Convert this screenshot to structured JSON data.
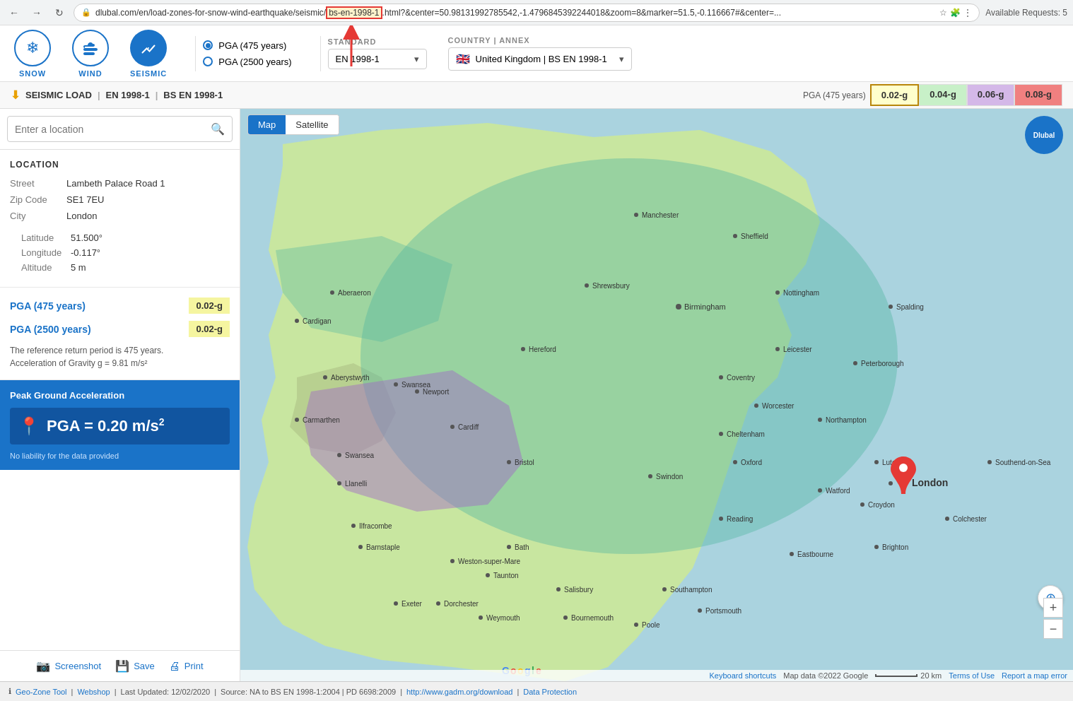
{
  "browser": {
    "url_prefix": "dlubal.com/en/load-zones-for-snow-wind-earthquake/seismic/",
    "url_highlight": "bs-en-1998-1",
    "url_suffix": ".html?&center=50.98131992785542,-1.4796845392244018&zoom=8&marker=51.5,-0.116667#&center=...",
    "back_label": "←",
    "forward_label": "→",
    "reload_label": "↺",
    "available_requests": "Available Requests: 5"
  },
  "nav": {
    "snow_label": "SNOW",
    "wind_label": "WIND",
    "seismic_label": "SEISMIC",
    "pga_475": "PGA (475 years)",
    "pga_2500": "PGA (2500 years)",
    "standard_label": "STANDARD",
    "standard_value": "EN 1998-1",
    "country_label": "COUNTRY | ANNEX",
    "country_value": "United Kingdom | BS EN 1998-1"
  },
  "toolbar": {
    "title": "SEISMIC LOAD",
    "sep1": "|",
    "std": "EN 1998-1",
    "sep2": "|",
    "annex": "BS EN 1998-1",
    "pga_label": "PGA (475 years)",
    "badge_1": "0.02-g",
    "badge_2": "0.04-g",
    "badge_3": "0.06-g",
    "badge_4": "0.08-g"
  },
  "sidebar": {
    "search_placeholder": "Enter a location",
    "location_title": "LOCATION",
    "street_label": "Street",
    "street_value": "Lambeth Palace Road 1",
    "zipcode_label": "Zip Code",
    "zipcode_value": "SE1 7EU",
    "city_label": "City",
    "city_value": "London",
    "latitude_label": "Latitude",
    "latitude_value": "51.500°",
    "longitude_label": "Longitude",
    "longitude_value": "-0.117°",
    "altitude_label": "Altitude",
    "altitude_value": "5 m",
    "pga_475_label": "PGA (475 years)",
    "pga_475_value": "0.02-g",
    "pga_2500_label": "PGA (2500 years)",
    "pga_2500_value": "0.02-g",
    "note": "The reference return period is 475 years.\nAcceleration of Gravity g = 9.81 m/s²",
    "pga_result_title": "Peak Ground Acceleration",
    "pga_result_value": "PGA = 0.20 m/s",
    "pga_superscript": "2",
    "disclaimer": "No liability for the data provided",
    "screenshot_btn": "Screenshot",
    "save_btn": "Save",
    "print_btn": "Print"
  },
  "map": {
    "tab_map": "Map",
    "tab_satellite": "Satellite",
    "attribution_keyboard": "Keyboard shortcuts",
    "attribution_data": "Map data ©2022 Google",
    "attribution_scale": "20 km",
    "attribution_terms": "Terms of Use",
    "attribution_report": "Report a map error",
    "zoom_in": "+",
    "zoom_out": "−"
  },
  "status_bar": {
    "tool": "Geo-Zone Tool",
    "sep": "|",
    "webshop": "Webshop",
    "last_updated": "Last Updated: 12/02/2020",
    "source": "Source: NA to BS EN 1998-1:2004 | PD 6698:2009",
    "gadm_link": "http://www.gadm.org/download",
    "data_protection": "Data Protection"
  }
}
